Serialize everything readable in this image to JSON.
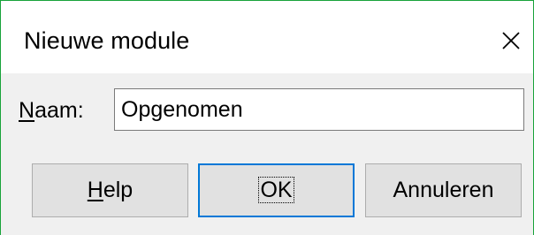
{
  "dialog": {
    "title": "Nieuwe module",
    "close_icon": "close-icon"
  },
  "form": {
    "name_label_accel": "N",
    "name_label_rest": "aam:",
    "name_value": "Opgenomen"
  },
  "buttons": {
    "help_accel": "H",
    "help_rest": "elp",
    "ok_label": "OK",
    "cancel_label": "Annuleren"
  },
  "colors": {
    "window_border": "#18a33a",
    "dialog_background": "#f0f0f0",
    "default_button_border": "#0078d7"
  }
}
